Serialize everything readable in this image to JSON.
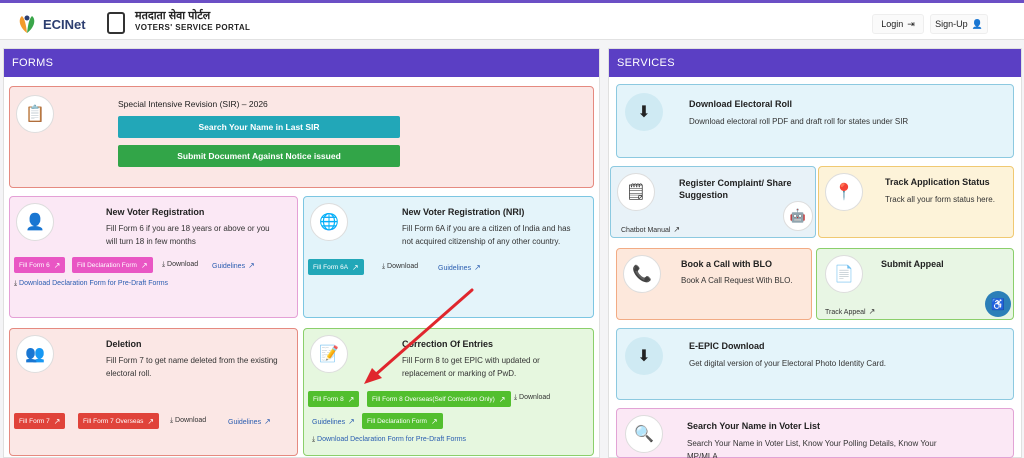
{
  "header": {
    "logo": "ECINet",
    "portal_hindi": "मतदाता सेवा पोर्टल",
    "portal_english": "VOTERS' SERVICE PORTAL",
    "login": "Login",
    "signup": "Sign-Up"
  },
  "forms": {
    "heading": "FORMS",
    "sir": {
      "title": "Special Intensive Revision (SIR) – 2026",
      "search_btn": "Search Your Name in Last SIR",
      "submit_btn": "Submit Document Against Notice issued"
    },
    "new_voter": {
      "title": "New Voter Registration",
      "desc": "Fill Form 6 if you are 18 years or above or you will turn 18 in few months",
      "btn_form6": "Fill Form 6",
      "btn_decl": "Fill Declaration Form",
      "download": "Download",
      "guidelines": "Guidelines",
      "decl_download": "Download Declaration Form for Pre-Draft Forms"
    },
    "nri": {
      "title": "New Voter Registration (NRI)",
      "desc": "Fill Form 6A if you are a citizen of India and has not acquired citizenship of any other country.",
      "btn": "Fill Form 6A",
      "download": "Download",
      "guidelines": "Guidelines"
    },
    "deletion": {
      "title": "Deletion",
      "desc": "Fill Form 7 to get name deleted from the existing electoral roll.",
      "btn_form7": "Fill Form 7",
      "btn_overseas": "Fill Form 7 Overseas",
      "download": "Download",
      "guidelines": "Guidelines"
    },
    "correction": {
      "title": "Correction Of Entries",
      "desc": "Fill Form 8 to get EPIC with updated or replacement or marking of PwD.",
      "btn_form8": "Fill Form 8",
      "btn_overseas": "Fill Form 8 Overseas(Self Correction Only)",
      "download": "Download",
      "guidelines": "Guidelines",
      "btn_decl": "Fill Declaration Form",
      "decl_download": "Download Declaration Form for Pre-Draft Forms"
    }
  },
  "services": {
    "heading": "SERVICES",
    "roll": {
      "title": "Download Electoral Roll",
      "desc": "Download electoral roll PDF and draft roll for states under SIR"
    },
    "complaint": {
      "title": "Register Complaint/ Share Suggestion",
      "manual": "Chatbot Manual"
    },
    "track": {
      "title": "Track Application Status",
      "desc": "Track all your form status here."
    },
    "blo": {
      "title": "Book a Call with BLO",
      "desc": "Book A Call Request With BLO."
    },
    "appeal": {
      "title": "Submit Appeal",
      "track": "Track Appeal"
    },
    "epic": {
      "title": "E-EPIC Download",
      "desc": "Get digital version of your Electoral Photo Identity Card."
    },
    "search": {
      "title": "Search Your Name in Voter List",
      "desc": "Search Your Name in Voter List, Know Your Polling Details, Know Your MP/MLA"
    }
  },
  "colors": {
    "header": "#5b3fc4",
    "teal_btn": "#22a7b8",
    "green_btn": "#32a548",
    "pink_btn": "#e956c4",
    "red_btn": "#e0433a",
    "lime_btn": "#52bf2e",
    "annotation_arrow": "#e0262d"
  },
  "icons": [
    "arrow-up-right-icon",
    "download-icon",
    "login-icon",
    "user-plus-icon"
  ]
}
